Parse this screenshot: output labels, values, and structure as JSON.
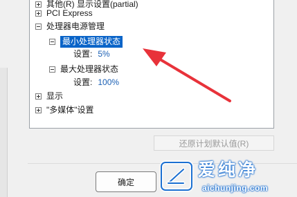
{
  "tree": {
    "items": [
      {
        "toggle": "plus",
        "label": "其他(R) 显示设置(partial)"
      },
      {
        "toggle": "plus",
        "label": "PCI Express"
      },
      {
        "toggle": "minus",
        "label": "处理器电源管理"
      },
      {
        "toggle": "minus",
        "label": "最小处理器状态"
      },
      {
        "setting_label": "设置:",
        "setting_value": "5%"
      },
      {
        "toggle": "minus",
        "label": "最大处理器状态"
      },
      {
        "setting_label": "设置:",
        "setting_value": "100%"
      },
      {
        "toggle": "plus",
        "label": "显示"
      },
      {
        "toggle": "plus",
        "label": "\"多媒体\"设置"
      }
    ]
  },
  "buttons": {
    "restore_defaults": "还原计划默认值(R)",
    "ok": "确定"
  },
  "watermark": {
    "title": "爱纯净",
    "url": "aichunjing.com"
  },
  "colors": {
    "selection": "#0a64c8",
    "value_text": "#1a5fb4",
    "arrow": "#e8323a",
    "watermark_blue": "#1b6fd1"
  }
}
